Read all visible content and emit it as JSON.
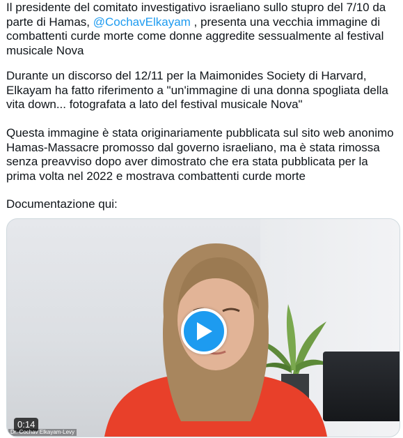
{
  "tweet": {
    "para1": {
      "before": "Il presidente del comitato investigativo israeliano sullo stupro del 7/10 da parte di Hamas, ",
      "mention": "@CochavElkayam",
      "after": " , presenta una vecchia immagine di combattenti curde morte come donne aggredite sessualmente al festival musicale Nova"
    },
    "para2": "Durante un discorso del 12/11 per la Maimonides Society di Harvard, Elkayam ha fatto riferimento a \"un'immagine di una donna spogliata della vita down... fotografata a lato del festival musicale Nova\"",
    "para3": "Questa immagine è stata originariamente pubblicata sul sito web anonimo Hamas-Massacre promosso dal governo israeliano, ma è stata rimossa senza preavviso dopo aver dimostrato che era stata pubblicata per la prima volta nel 2022 e mostrava combattenti curde morte",
    "para4": "Documentazione qui:"
  },
  "video": {
    "timestamp": "0:14",
    "caption": "Dr. Cochav Elkayam-Levy",
    "play_icon": "play-icon"
  },
  "colors": {
    "mention": "#1d9bf0",
    "play_button": "#1d9bf0",
    "jacket": "#e8402a"
  }
}
